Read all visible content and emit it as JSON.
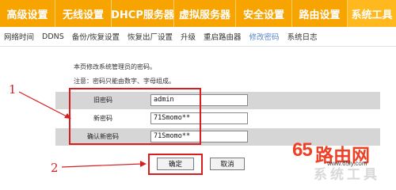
{
  "top_nav": {
    "items": [
      "高级设置",
      "无线设置",
      "DHCP服务器",
      "虚拟服务器",
      "安全设置",
      "路由设置",
      "系统工具"
    ]
  },
  "sub_nav": {
    "items": [
      "网络时间",
      "DDNS",
      "备份/恢复设置",
      "恢复出厂设置",
      "升级",
      "重启路由器",
      "修改密码",
      "系统日志"
    ]
  },
  "page": {
    "description": "本页修改系统管理员的密码。",
    "note": "注意：密码只能由数字、字母组成。"
  },
  "form": {
    "old_password_label": "旧密码",
    "old_password_value": "admin",
    "new_password_label": "新密码",
    "new_password_value": "71Smomo**",
    "confirm_password_label": "确认新密码",
    "confirm_password_value": "71Smomo**"
  },
  "buttons": {
    "ok_label": "确定",
    "cancel_label": "取消"
  },
  "annotations": {
    "marker_1": "1",
    "marker_2": "2"
  },
  "watermark": {
    "brand_num": "65",
    "brand_text": "路由网",
    "url": "www.65ly.com",
    "partial_chars": "系统工具"
  },
  "colors": {
    "nav_orange": "#f7a300",
    "annotation_red": "#d81e1e",
    "active_link_blue": "#5b87c8",
    "row_shade": "#d6d6d6"
  }
}
